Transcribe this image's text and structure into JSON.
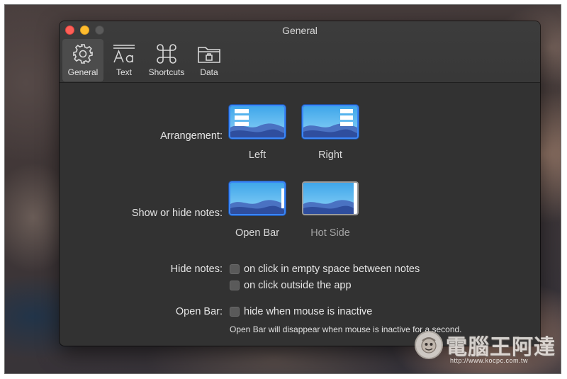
{
  "window": {
    "title": "General",
    "traffic_lights": [
      "close",
      "minimize",
      "maximize"
    ]
  },
  "toolbar": {
    "items": [
      {
        "label": "General",
        "icon": "gear-icon",
        "active": true
      },
      {
        "label": "Text",
        "icon": "text-format-icon",
        "active": false
      },
      {
        "label": "Shortcuts",
        "icon": "command-icon",
        "active": false
      },
      {
        "label": "Data",
        "icon": "folder-icon",
        "active": false
      }
    ]
  },
  "arrangement": {
    "label": "Arrangement:",
    "options": [
      {
        "caption": "Left",
        "selected": true
      },
      {
        "caption": "Right",
        "selected": true
      }
    ]
  },
  "show_hide": {
    "label": "Show or hide notes:",
    "options": [
      {
        "caption": "Open Bar",
        "selected": true
      },
      {
        "caption": "Hot Side",
        "selected": false
      }
    ]
  },
  "hide_notes": {
    "label": "Hide notes:",
    "options": [
      {
        "text": "on click in empty space between notes",
        "checked": false
      },
      {
        "text": "on click outside the app",
        "checked": false
      }
    ]
  },
  "open_bar": {
    "label": "Open Bar:",
    "option": {
      "text": "hide when mouse is inactive",
      "checked": false
    },
    "hint": "Open Bar will disappear when mouse is inactive for a second."
  },
  "watermark": {
    "text": "電腦王阿達",
    "url": "http://www.kocpc.com.tw"
  },
  "colors": {
    "window_bg": "#323232",
    "accent": "#3a85f6",
    "close": "#fe5f57",
    "minimize": "#febc2e"
  }
}
